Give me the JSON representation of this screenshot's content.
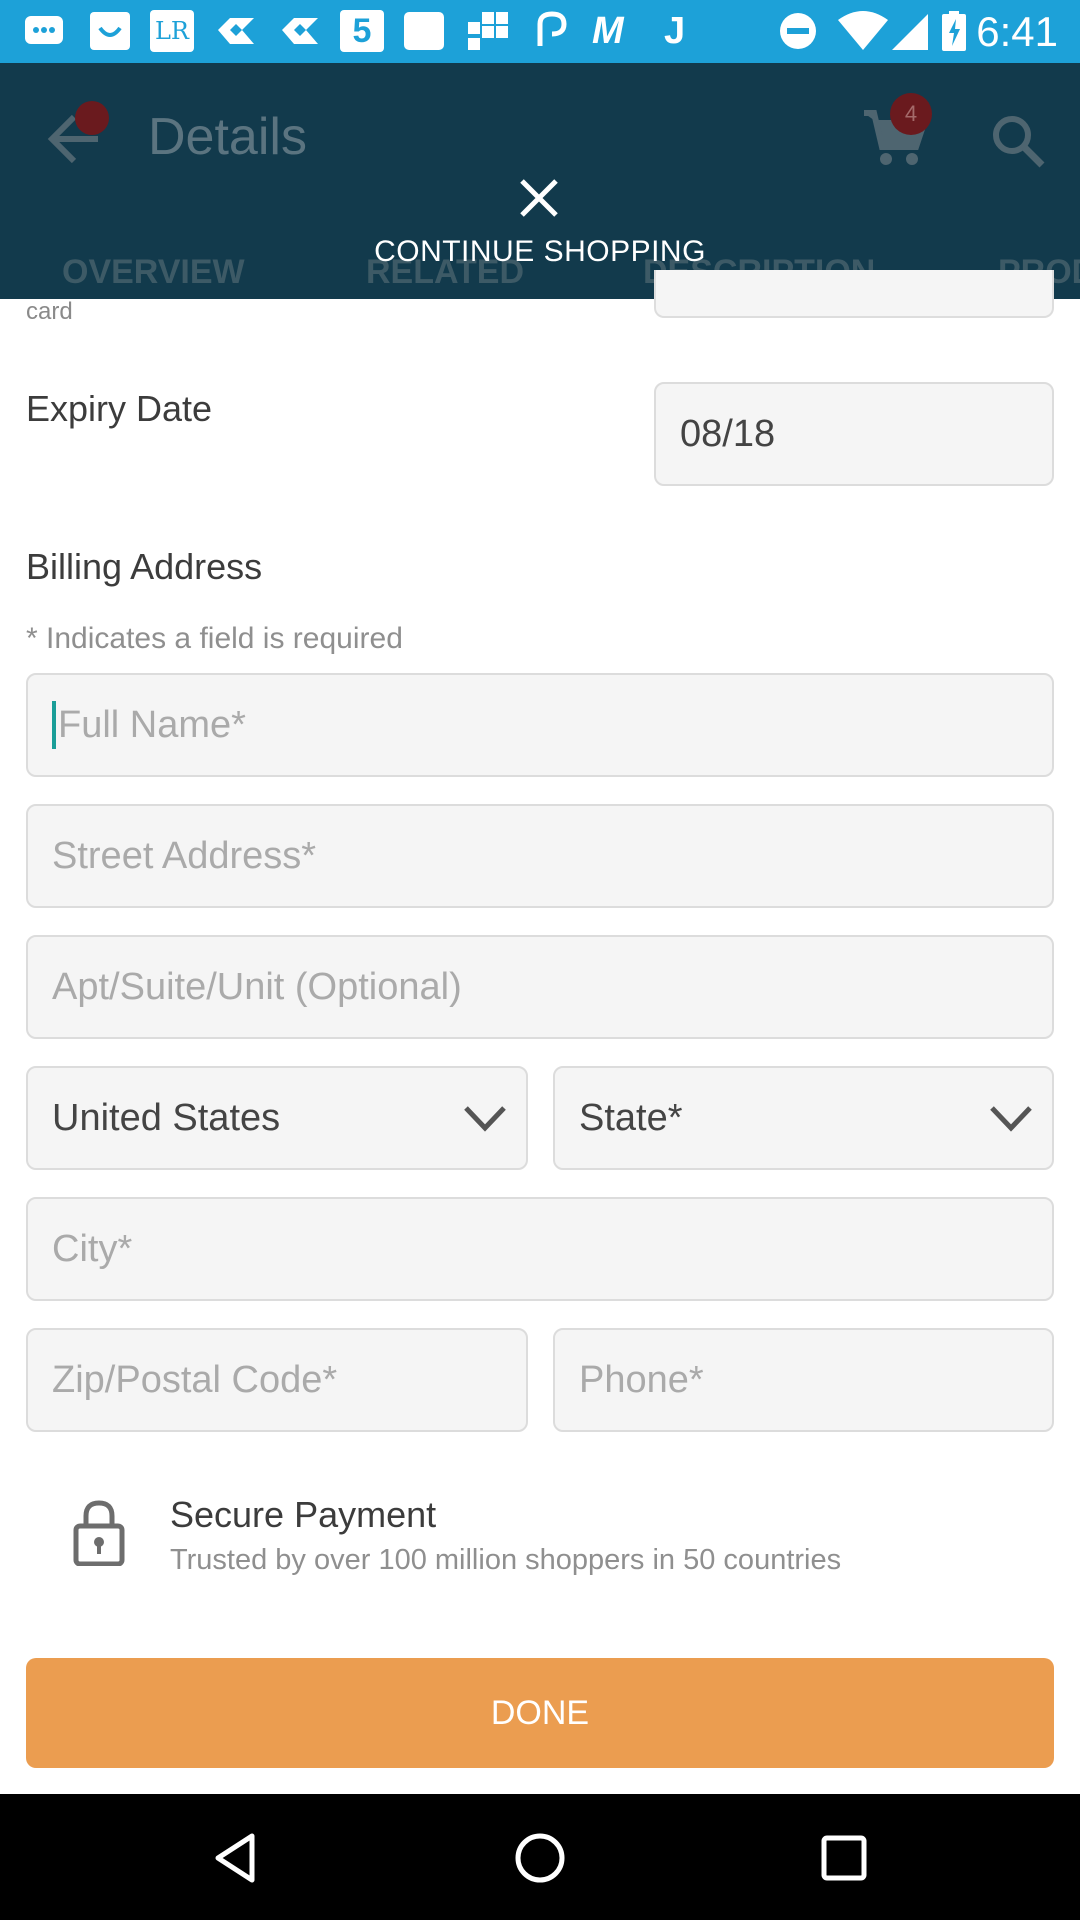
{
  "status_bar": {
    "time": "6:41",
    "left_icons": [
      "messaging-icon",
      "smile-app-icon",
      "lr-app-icon",
      "dropbox-icon",
      "dropbox-icon",
      "app5-icon",
      "blank-app-icon",
      "grid-app-icon",
      "link-app-icon",
      "m-app-icon",
      "j-app-icon"
    ],
    "lr_text": "LR",
    "five_text": "5",
    "m_text": "M",
    "j_text": "J",
    "right_icons": [
      "do-not-disturb-icon",
      "wifi-icon",
      "signal-icon",
      "battery-charging-icon"
    ]
  },
  "app_bar": {
    "title": "Details",
    "cart_count": "4",
    "tabs": [
      "OVERVIEW",
      "RELATED",
      "DESCRIPTION",
      "PROD"
    ],
    "overlay_label": "CONTINUE SHOPPING"
  },
  "form": {
    "card_label_fragment": "card",
    "expiry_label": "Expiry Date",
    "expiry_value": "08/18",
    "billing_title": "Billing Address",
    "required_note": "* Indicates a field is required",
    "full_name_placeholder": "Full Name*",
    "street_placeholder": "Street Address*",
    "apt_placeholder": "Apt/Suite/Unit (Optional)",
    "country_value": "United States",
    "state_value": "State*",
    "city_placeholder": "City*",
    "zip_placeholder": "Zip/Postal Code*",
    "phone_placeholder": "Phone*"
  },
  "secure": {
    "title": "Secure Payment",
    "subtitle": "Trusted by over 100 million shoppers in 50 countries"
  },
  "done_label": "DONE",
  "colors": {
    "status_bar": "#1da1d8",
    "app_bar": "#123a4c",
    "done_button": "#eb9d50",
    "cursor": "#1a9e98",
    "badge": "#6a1a1e"
  }
}
